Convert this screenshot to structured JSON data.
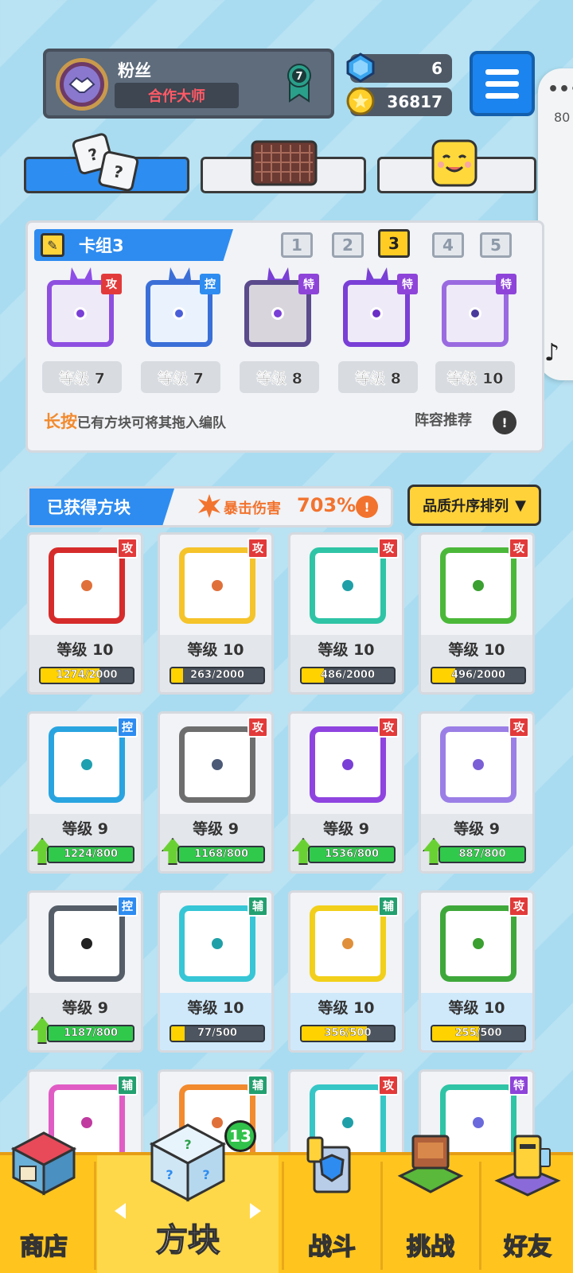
{
  "profile": {
    "nickname": "粉丝",
    "title": "合作大师",
    "rank": "7"
  },
  "currency": {
    "gems": "6",
    "coins": "36817"
  },
  "side_float": {
    "dots": "•••",
    "number": "80",
    "music_icon": "music-note-icon"
  },
  "deck": {
    "title": "卡组3",
    "numbers": [
      "1",
      "2",
      "3",
      "4",
      "5"
    ],
    "active_index": 2,
    "slots": [
      {
        "tag": "攻",
        "level": "等级 7",
        "color": "#8e4fe0"
      },
      {
        "tag": "控",
        "level": "等级 7",
        "color": "#3b6fd8"
      },
      {
        "tag": "特",
        "level": "等级 8",
        "color": "#5b4a8c"
      },
      {
        "tag": "特",
        "level": "等级 8",
        "color": "#7a3fd6"
      },
      {
        "tag": "特",
        "level": "等级 10",
        "color": "#9a6be0"
      }
    ],
    "hint_highlight": "长按",
    "hint_text": "已有方块可将其拖入编队",
    "recommend": "阵容推荐"
  },
  "owned": {
    "title": "已获得方块",
    "crit_label": "暴击伤害",
    "crit_value": "703%",
    "sort_label": "品质升序排列"
  },
  "blocks": [
    {
      "tag": "攻",
      "level": "等级 10",
      "progress": "1274/2000",
      "fill": 0.64,
      "color": "#d62b2b",
      "dot": "#e0703a",
      "up": false,
      "bg": "grey"
    },
    {
      "tag": "攻",
      "level": "等级 10",
      "progress": "263/2000",
      "fill": 0.13,
      "color": "#f5c32a",
      "dot": "#e0703a",
      "up": false,
      "bg": "grey"
    },
    {
      "tag": "攻",
      "level": "等级 10",
      "progress": "486/2000",
      "fill": 0.24,
      "color": "#2fc4a6",
      "dot": "#1fa0a8",
      "up": false,
      "bg": "grey"
    },
    {
      "tag": "攻",
      "level": "等级 10",
      "progress": "496/2000",
      "fill": 0.25,
      "color": "#4cb83a",
      "dot": "#3aa030",
      "up": false,
      "bg": "grey"
    },
    {
      "tag": "控",
      "level": "等级 9",
      "progress": "1224/800",
      "fill": 1,
      "color": "#29a4e0",
      "dot": "#1fa0b0",
      "up": true,
      "bg": "grey"
    },
    {
      "tag": "攻",
      "level": "等级 9",
      "progress": "1168/800",
      "fill": 1,
      "color": "#6e6e6e",
      "dot": "#4c5a78",
      "up": true,
      "bg": "grey"
    },
    {
      "tag": "攻",
      "level": "等级 9",
      "progress": "1536/800",
      "fill": 1,
      "color": "#8f44e0",
      "dot": "#7a3fd6",
      "up": true,
      "bg": "grey"
    },
    {
      "tag": "攻",
      "level": "等级 9",
      "progress": "887/800",
      "fill": 1,
      "color": "#9b7fe6",
      "dot": "#7a5fd6",
      "up": true,
      "bg": "grey"
    },
    {
      "tag": "控",
      "level": "等级 9",
      "progress": "1187/800",
      "fill": 1,
      "color": "#555d68",
      "dot": "#222",
      "up": true,
      "bg": "grey"
    },
    {
      "tag": "辅",
      "level": "等级 10",
      "progress": "77/500",
      "fill": 0.15,
      "color": "#36c6d6",
      "dot": "#1fa0a8",
      "up": false,
      "bg": "blue"
    },
    {
      "tag": "辅",
      "level": "等级 10",
      "progress": "356/500",
      "fill": 0.71,
      "color": "#f2cf1a",
      "dot": "#e0903a",
      "up": false,
      "bg": "blue"
    },
    {
      "tag": "攻",
      "level": "等级 10",
      "progress": "255/500",
      "fill": 0.51,
      "color": "#3fa83a",
      "dot": "#3aa030",
      "up": false,
      "bg": "blue"
    },
    {
      "tag": "辅",
      "level": "",
      "progress": "",
      "fill": 0,
      "color": "#e05cc4",
      "dot": "#c03aa0",
      "up": false,
      "bg": "grey"
    },
    {
      "tag": "辅",
      "level": "",
      "progress": "",
      "fill": 0,
      "color": "#f28a2e",
      "dot": "#e0703a",
      "up": false,
      "bg": "grey"
    },
    {
      "tag": "攻",
      "level": "",
      "progress": "",
      "fill": 0,
      "color": "#36c6c6",
      "dot": "#1fa0a8",
      "up": false,
      "bg": "grey"
    },
    {
      "tag": "特",
      "level": "",
      "progress": "",
      "fill": 0,
      "color": "#2fc4a6",
      "dot": "#6a6adc",
      "up": false,
      "bg": "grey"
    }
  ],
  "nav": {
    "shop": "商店",
    "blocks": "方块",
    "blocks_badge": "13",
    "battle": "战斗",
    "challenge": "挑战",
    "friends": "好友"
  },
  "colors": {
    "attack_tag": "#e23a3a",
    "control_tag": "#2e8cf0",
    "special_tag": "#8e44d9",
    "support_tag": "#23a070",
    "accent_blue": "#2e8cf0",
    "nav_yellow": "#ffc51e"
  }
}
